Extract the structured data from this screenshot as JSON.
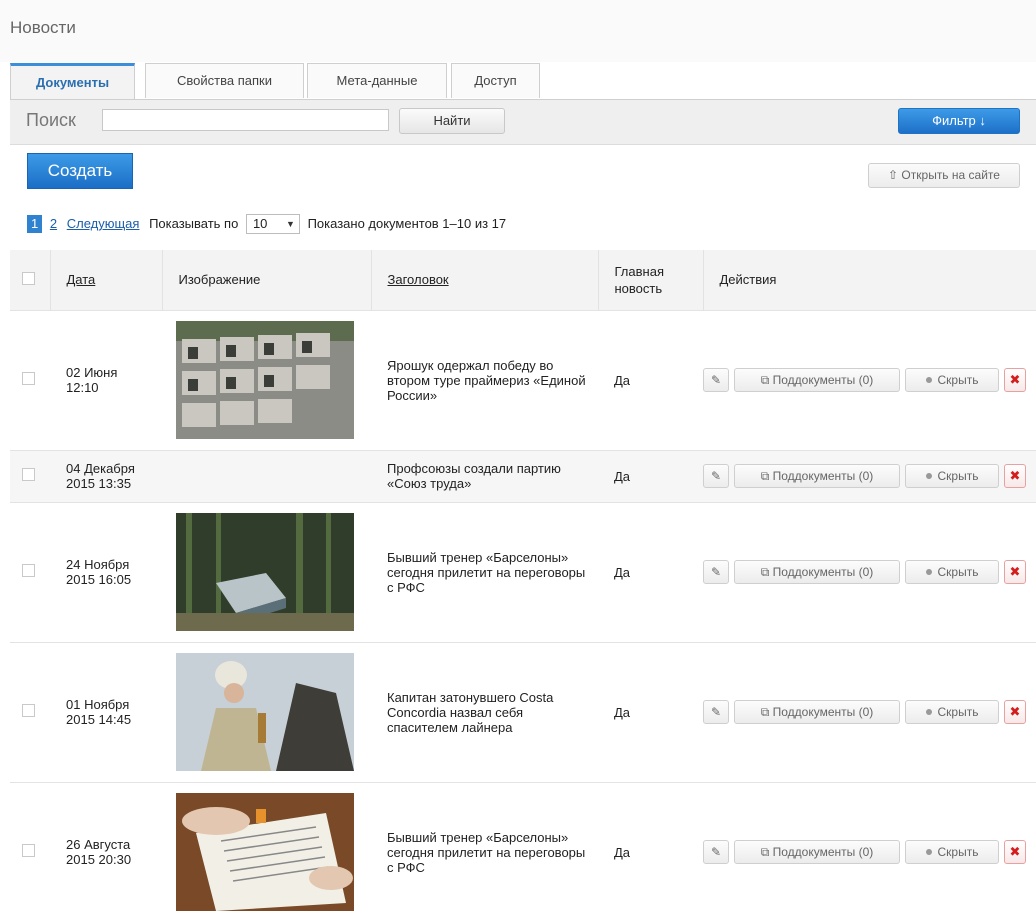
{
  "header": {
    "title": "Новости"
  },
  "tabs": [
    {
      "label": "Документы",
      "active": true
    },
    {
      "label": "Свойства папки",
      "active": false
    },
    {
      "label": "Мета-данные",
      "active": false
    },
    {
      "label": "Доступ",
      "active": false
    }
  ],
  "search": {
    "label": "Поиск",
    "value": "",
    "button": "Найти",
    "filter_button": "Фильтр ↓"
  },
  "toolbar": {
    "create": "Создать",
    "open_site": "⇧ Открыть на сайте"
  },
  "pager": {
    "current": "1",
    "page2": "2",
    "next": "Следующая",
    "show_by_label": "Показывать по",
    "per_page": "10",
    "summary": "Показано документов 1–10 из 17"
  },
  "columns": {
    "date": "Дата",
    "image": "Изображение",
    "title": "Заголовок",
    "main": "Главная новость",
    "actions": "Действия"
  },
  "actions": {
    "sub": "Поддокументы (0)",
    "hide": "Скрыть",
    "delete": "✖",
    "edit": "✎"
  },
  "rows": [
    {
      "date": "02 Июня 12:10",
      "title": "Ярошук одержал победу во втором туре праймериз «Единой России»",
      "main": "Да",
      "image": "concrete-blocks"
    },
    {
      "date": "04 Декабря 2015 13:35",
      "title": "Профсоюзы создали партию «Союз труда»",
      "main": "Да",
      "image": ""
    },
    {
      "date": "24 Ноября 2015 16:05",
      "title": "Бывший тренер «Барселоны» сегодня прилетит на переговоры с РФС",
      "main": "Да",
      "image": "forest"
    },
    {
      "date": "01 Ноября 2015 14:45",
      "title": "Капитан затонувшего Costa Concordia назвал себя спасителем лайнера",
      "main": "Да",
      "image": "priest"
    },
    {
      "date": "26 Августа 2015 20:30",
      "title": "Бывший тренер «Барселоны» сегодня прилетит на переговоры с РФС",
      "main": "Да",
      "image": "document-signing"
    }
  ]
}
